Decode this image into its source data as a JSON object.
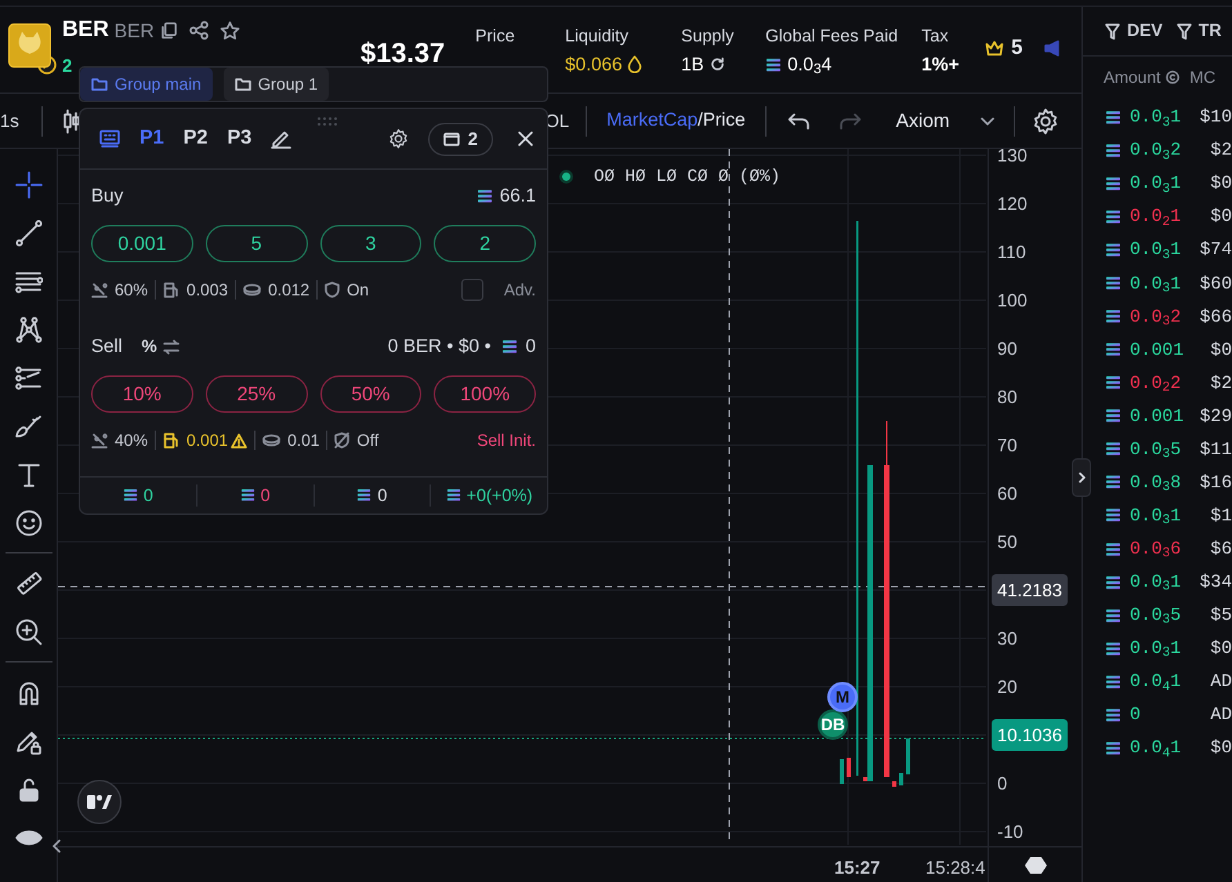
{
  "token": {
    "name": "BER",
    "ticker": "BER",
    "age": "2"
  },
  "market_cap": "$13.37",
  "stats": [
    {
      "label": "Price",
      "kind": "covered"
    },
    {
      "label": "Liquidity",
      "value": "$0.066",
      "kind": "liquidity"
    },
    {
      "label": "Supply",
      "value": "1B",
      "kind": "supply"
    },
    {
      "label": "Global Fees Paid",
      "value": "0.0$_{3}$4",
      "kind": "fees"
    },
    {
      "label": "Tax",
      "value": "1%+",
      "kind": "plain"
    }
  ],
  "crown_count": "5",
  "toolbar": {
    "interval": "1s",
    "currency": "OL",
    "metric": "MarketCap",
    "metric_alt": "/Price",
    "theme": "Axiom"
  },
  "legend": "OØ HØ LØ CØ Ø (Ø%)",
  "y_axis": [
    {
      "label": "130"
    },
    {
      "label": "120"
    },
    {
      "label": "110"
    },
    {
      "label": "100"
    },
    {
      "label": "90"
    },
    {
      "label": "80"
    },
    {
      "label": "70"
    },
    {
      "label": "60"
    },
    {
      "label": "50"
    },
    {
      "label": "41.2183",
      "kind": "crosshair"
    },
    {
      "label": "30"
    },
    {
      "label": "20"
    },
    {
      "label": "10.1036",
      "kind": "last"
    },
    {
      "label": "0"
    },
    {
      "label": "-10"
    }
  ],
  "time_axis": [
    {
      "label": "15:27",
      "kind": "bold"
    },
    {
      "label": "15:28:4",
      "kind": "plain"
    }
  ],
  "markers": [
    {
      "label": "M",
      "kind": "migration"
    },
    {
      "label": "DB",
      "kind": "dev-buy"
    }
  ],
  "panel": {
    "group_tabs": [
      {
        "label": "Group main",
        "selected": true
      },
      {
        "label": "Group 1",
        "selected": false
      }
    ],
    "presets": [
      {
        "label": "P1",
        "selected": true
      },
      {
        "label": "P2",
        "selected": false
      },
      {
        "label": "P3",
        "selected": false
      }
    ],
    "wallet_count": "2",
    "buy": {
      "title": "Buy",
      "balance": "66.1",
      "amounts": [
        "0.001",
        "5",
        "3",
        "2"
      ],
      "settings": [
        {
          "kind": "slippage",
          "value": "60%"
        },
        {
          "kind": "gas",
          "value": "0.003",
          "warning": false
        },
        {
          "kind": "tip",
          "value": "0.012"
        },
        {
          "kind": "protect",
          "value": "On"
        }
      ],
      "advanced": {
        "label": "Adv.",
        "checked": false
      }
    },
    "sell": {
      "title": "Sell",
      "unit": "%",
      "holdings": "0 BER • $0 •",
      "balance": "0",
      "amounts": [
        "10%",
        "25%",
        "50%",
        "100%"
      ],
      "settings": [
        {
          "kind": "slippage",
          "value": "40%"
        },
        {
          "kind": "gas",
          "value": "0.001",
          "warning": true
        },
        {
          "kind": "tip",
          "value": "0.01"
        },
        {
          "kind": "protect-off",
          "value": "Off"
        }
      ],
      "action": "Sell Init."
    },
    "totals": [
      {
        "value": "0",
        "kind": "bought"
      },
      {
        "value": "0",
        "kind": "sold"
      },
      {
        "value": "0",
        "kind": "holding"
      },
      {
        "value": "+0(+0%)",
        "kind": "pnl"
      }
    ]
  },
  "trades": {
    "filters": [
      "DEV",
      "TR"
    ],
    "columns": [
      "Amount",
      "MC"
    ],
    "rows": [
      {
        "amount": "0.0$_{3}$1",
        "mc": "$10",
        "color": "#2bd99f"
      },
      {
        "amount": "0.0$_{3}$2",
        "mc": "$2",
        "color": "#2bd99f"
      },
      {
        "amount": "0.0$_{3}$1",
        "mc": "$0",
        "color": "#2bd99f"
      },
      {
        "amount": "0.0$_{2}$1",
        "mc": "$0",
        "color": "#f0304f"
      },
      {
        "amount": "0.0$_{3}$1",
        "mc": "$74",
        "color": "#2bd99f"
      },
      {
        "amount": "0.0$_{3}$1",
        "mc": "$60",
        "color": "#2bd99f"
      },
      {
        "amount": "0.0$_{3}$2",
        "mc": "$66",
        "color": "#f0304f"
      },
      {
        "amount": "0.001",
        "mc": "$0",
        "color": "#2bd99f"
      },
      {
        "amount": "0.0$_{2}$2",
        "mc": "$2",
        "color": "#f0304f"
      },
      {
        "amount": "0.001",
        "mc": "$29",
        "color": "#2bd99f"
      },
      {
        "amount": "0.0$_{3}$5",
        "mc": "$11",
        "color": "#2bd99f"
      },
      {
        "amount": "0.0$_{3}$8",
        "mc": "$16",
        "color": "#2bd99f"
      },
      {
        "amount": "0.0$_{3}$1",
        "mc": "$1",
        "color": "#2bd99f"
      },
      {
        "amount": "0.0$_{3}$6",
        "mc": "$6",
        "color": "#f0304f"
      },
      {
        "amount": "0.0$_{3}$1",
        "mc": "$34",
        "color": "#2bd99f"
      },
      {
        "amount": "0.0$_{3}$5",
        "mc": "$5",
        "color": "#2bd99f"
      },
      {
        "amount": "0.0$_{3}$1",
        "mc": "$0",
        "color": "#2bd99f"
      },
      {
        "amount": "0.0$_{4}$1",
        "mc": "AD",
        "color": "#2bd99f"
      },
      {
        "amount": "0",
        "mc": "AD",
        "color": "#2bd99f"
      },
      {
        "amount": "0.0$_{4}$1",
        "mc": "$0",
        "color": "#2bd99f"
      }
    ]
  }
}
